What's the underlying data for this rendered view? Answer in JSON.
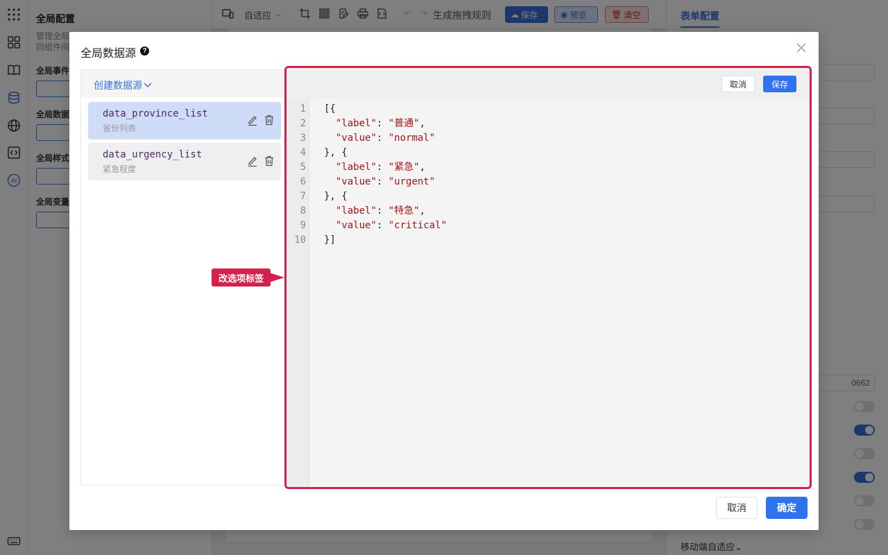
{
  "global_panel": {
    "title": "全局配置",
    "desc_line1": "管理全局",
    "desc_line2": "同组件间",
    "labels": [
      "全局事件",
      "全局数据",
      "全局样式",
      "全局变量"
    ]
  },
  "toolbar": {
    "adapt": "自适应",
    "drag_rule": "生成拖拽规则",
    "save": "保存",
    "preview": "预览",
    "clear": "清空"
  },
  "right_panel": {
    "tab": "表单配置",
    "field_value": "0662",
    "mobile_adapt": "移动端自适应",
    "switches": [
      false,
      true,
      false,
      true,
      false,
      false
    ]
  },
  "dialog": {
    "title": "全局数据源",
    "help_icon": "question-circle-icon",
    "create_label": "创建数据源",
    "datasources": [
      {
        "name": "data_province_list",
        "desc": "省份列表",
        "active": true
      },
      {
        "name": "data_urgency_list",
        "desc": "紧急程度",
        "active": false
      }
    ],
    "editor_cancel": "取消",
    "editor_save": "保存",
    "code_lines": [
      "[{",
      "  \"label\": \"普通\",",
      "  \"value\": \"normal\"",
      "}, {",
      "  \"label\": \"紧急\",",
      "  \"value\": \"urgent\"",
      "}, {",
      "  \"label\": \"特急\",",
      "  \"value\": \"critical\"",
      "}]"
    ],
    "line_numbers": [
      "1",
      "2",
      "3",
      "4",
      "5",
      "6",
      "7",
      "8",
      "9",
      "10"
    ],
    "callout": "改选项标签",
    "cancel": "取消",
    "confirm": "确定"
  },
  "colors": {
    "primary": "#2f72ed",
    "highlight": "#d4204d"
  }
}
